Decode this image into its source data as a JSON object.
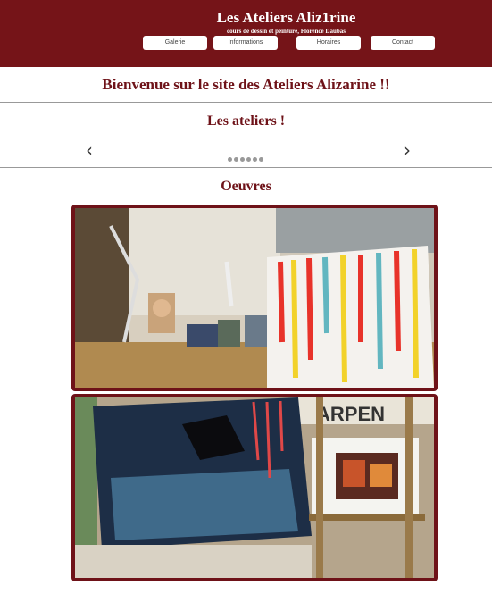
{
  "header": {
    "title": "Les Ateliers Aliz1rine",
    "subtitle": "cours de dessin et peinture, Florence Daubas",
    "nav": [
      "Galerie",
      "Informations",
      "Horaires",
      "Contact"
    ]
  },
  "main": {
    "welcome": "Bienvenue sur le site des Ateliers Alizarine !!",
    "ateliers_title": "Les ateliers !",
    "carousel": {
      "prev": "‹",
      "next": "›",
      "dot_count": 6
    },
    "oeuvres_title": "Oeuvres",
    "photos": [
      {
        "name": "atelier-photo-1",
        "sign_text": ""
      },
      {
        "name": "atelier-photo-2",
        "sign_text": "ARPEN"
      }
    ]
  },
  "colors": {
    "brand": "#751418",
    "title": "#6e1218"
  }
}
